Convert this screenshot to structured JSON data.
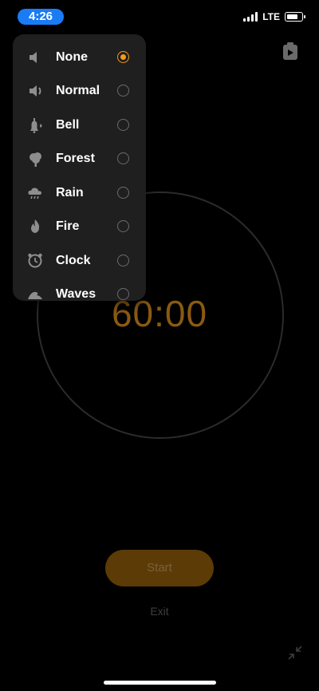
{
  "status_bar": {
    "time": "4:26",
    "network": "LTE"
  },
  "sound_menu": {
    "items": [
      {
        "label": "None",
        "icon": "speaker-muted-icon",
        "selected": true
      },
      {
        "label": "Normal",
        "icon": "speaker-icon",
        "selected": false
      },
      {
        "label": "Bell",
        "icon": "bell-icon",
        "selected": false
      },
      {
        "label": "Forest",
        "icon": "tree-icon",
        "selected": false
      },
      {
        "label": "Rain",
        "icon": "rain-cloud-icon",
        "selected": false
      },
      {
        "label": "Fire",
        "icon": "flame-icon",
        "selected": false
      },
      {
        "label": "Clock",
        "icon": "alarm-clock-icon",
        "selected": false
      },
      {
        "label": "Waves",
        "icon": "wave-icon",
        "selected": false
      }
    ]
  },
  "timer": {
    "display": "60:00"
  },
  "actions": {
    "start_label": "Start",
    "exit_label": "Exit"
  },
  "colors": {
    "accent": "#f39a1d",
    "timer_text": "#8a5a11",
    "start_button": "#5c3b06",
    "status_pill": "#1a7cf5"
  }
}
